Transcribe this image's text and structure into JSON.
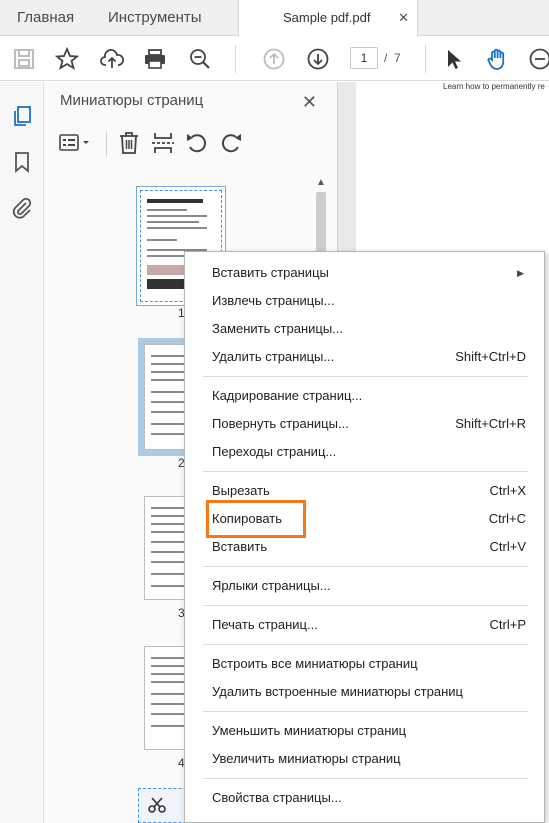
{
  "tabs": {
    "home": "Главная",
    "tools": "Инструменты",
    "document": "Sample pdf.pdf",
    "close": "✕"
  },
  "toolbar": {
    "current_page": "1",
    "separator": "/",
    "total_pages": "7"
  },
  "panel": {
    "title": "Миниатюры страниц",
    "close": "✕",
    "thumbnails": [
      {
        "number": "1"
      },
      {
        "number": "2"
      },
      {
        "number": "3"
      },
      {
        "number": "4"
      }
    ]
  },
  "document": {
    "snippet": "Learn how to permanently re"
  },
  "context_menu": {
    "items": [
      {
        "label": "Вставить страницы",
        "shortcut": "",
        "submenu": true
      },
      {
        "label": "Извлечь страницы...",
        "shortcut": ""
      },
      {
        "label": "Заменить страницы...",
        "shortcut": ""
      },
      {
        "label": "Удалить страницы...",
        "shortcut": "Shift+Ctrl+D"
      },
      {
        "label": "Кадрирование страниц...",
        "shortcut": ""
      },
      {
        "label": "Повернуть страницы...",
        "shortcut": "Shift+Ctrl+R"
      },
      {
        "label": "Переходы страниц...",
        "shortcut": ""
      },
      {
        "label": "Вырезать",
        "shortcut": "Ctrl+X"
      },
      {
        "label": "Копировать",
        "shortcut": "Ctrl+C"
      },
      {
        "label": "Вставить",
        "shortcut": "Ctrl+V"
      },
      {
        "label": "Ярлыки страницы...",
        "shortcut": ""
      },
      {
        "label": "Печать страниц...",
        "shortcut": "Ctrl+P"
      },
      {
        "label": "Встроить все миниатюры страниц",
        "shortcut": ""
      },
      {
        "label": "Удалить встроенные миниатюры страниц",
        "shortcut": ""
      },
      {
        "label": "Уменьшить миниатюры страниц",
        "shortcut": ""
      },
      {
        "label": "Увеличить миниатюры страниц",
        "shortcut": ""
      },
      {
        "label": "Свойства страницы...",
        "shortcut": ""
      }
    ],
    "highlighted_item": "Копировать",
    "highlight_color": "#f07a1d"
  },
  "icons": {
    "toolbar": [
      "save-icon",
      "star-icon",
      "upload-cloud-icon",
      "print-icon",
      "zoom-out-search-icon",
      "page-up-icon",
      "page-down-icon",
      "select-arrow-icon",
      "hand-tool-icon",
      "zoom-out-icon"
    ],
    "rail": [
      "pages-icon",
      "bookmark-icon",
      "attachment-icon"
    ],
    "panel": [
      "options-menu-icon",
      "trash-icon",
      "insert-page-icon",
      "rotate-ccw-icon",
      "rotate-cw-icon"
    ]
  },
  "colors": {
    "accent": "#1a73c8",
    "selection_blue": "#a9cbe6"
  }
}
